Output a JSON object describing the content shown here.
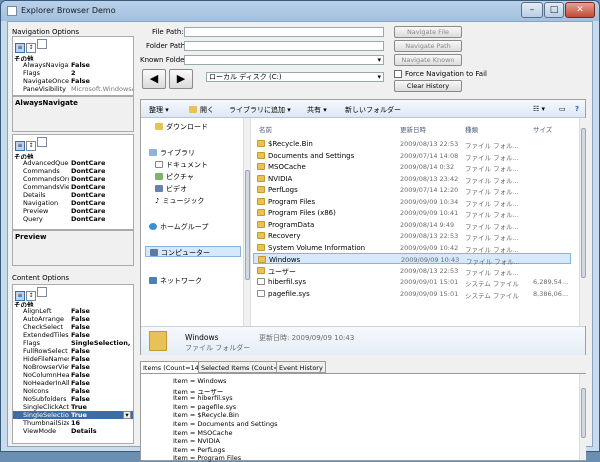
{
  "window": {
    "title": "Explorer Browser Demo",
    "min": "–",
    "max": "□",
    "close": "✕"
  },
  "nav_options": {
    "label": "Navigation Options",
    "category": "その他",
    "rows": [
      {
        "k": "AlwaysNavigate",
        "v": "False"
      },
      {
        "k": "Flags",
        "v": "2"
      },
      {
        "k": "NavigateOnce",
        "v": "False"
      },
      {
        "k": "PaneVisibility",
        "v": "Microsoft.WindowsAP"
      }
    ],
    "description": "AlwaysNavigate"
  },
  "preview_options": {
    "category": "その他",
    "rows": [
      {
        "k": "AdvancedQuery",
        "v": "DontCare"
      },
      {
        "k": "Commands",
        "v": "DontCare"
      },
      {
        "k": "CommandsOrga",
        "v": "DontCare"
      },
      {
        "k": "CommandsView",
        "v": "DontCare"
      },
      {
        "k": "Details",
        "v": "DontCare"
      },
      {
        "k": "Navigation",
        "v": "DontCare"
      },
      {
        "k": "Preview",
        "v": "DontCare"
      },
      {
        "k": "Query",
        "v": "DontCare"
      }
    ],
    "description": "Preview"
  },
  "content_options": {
    "label": "Content Options",
    "category": "その他",
    "rows": [
      {
        "k": "AlignLeft",
        "v": "False"
      },
      {
        "k": "AutoArrange",
        "v": "False"
      },
      {
        "k": "CheckSelect",
        "v": "False"
      },
      {
        "k": "ExtendedTiles",
        "v": "False"
      },
      {
        "k": "Flags",
        "v": "SingleSelection, S"
      },
      {
        "k": "FullRowSelect",
        "v": "False"
      },
      {
        "k": "HideFileNames",
        "v": "False"
      },
      {
        "k": "NoBrowserView",
        "v": "False"
      },
      {
        "k": "NoColumnHead",
        "v": "False"
      },
      {
        "k": "NoHeaderInAllV",
        "v": "False"
      },
      {
        "k": "NoIcons",
        "v": "False"
      },
      {
        "k": "NoSubfolders",
        "v": "False"
      },
      {
        "k": "SingleClickActi",
        "v": "True"
      },
      {
        "k": "SingleSelection",
        "v": "True"
      },
      {
        "k": "ThumbnailSize",
        "v": "16"
      },
      {
        "k": "ViewMode",
        "v": "Details"
      }
    ]
  },
  "top": {
    "file_path_label": "File Path:",
    "folder_path_label": "Folder Path:",
    "known_folder_label": "Known Folder:",
    "file_path": "",
    "folder_path": "",
    "known_folder": "",
    "location": "ローカル ディスク (C:)",
    "back": "◀",
    "forward": "▶",
    "navigate_file": "Navigate File",
    "navigate_path": "Navigate Path",
    "navigate_known": "Navigate Known",
    "force_nav": "Force Navigation to Fail",
    "clear_history": "Clear History"
  },
  "commandbar": {
    "organize": "整理 ▾",
    "open": "開く",
    "add_library": "ライブラリに追加 ▾",
    "share": "共有 ▾",
    "new_folder": "新しいフォルダー"
  },
  "navpane": {
    "downloads": "ダウンロード",
    "libraries": "ライブラリ",
    "documents": "ドキュメント",
    "pictures": "ピクチャ",
    "videos": "ビデオ",
    "music": "ミュージック",
    "homegroup": "ホームグループ",
    "computer": "コンピューター",
    "network": "ネットワーク"
  },
  "files": {
    "headers": {
      "name": "名前",
      "date": "更新日時",
      "type": "種類",
      "size": "サイズ"
    },
    "rows": [
      {
        "n": "$Recycle.Bin",
        "d": "2009/08/13 22:53",
        "t": "ファイル フォル...",
        "s": "",
        "doc": false,
        "sel": false
      },
      {
        "n": "Documents and Settings",
        "d": "2009/07/14 14:08",
        "t": "ファイル フォル...",
        "s": "",
        "doc": false,
        "sel": false
      },
      {
        "n": "MSOCache",
        "d": "2009/08/14 0:32",
        "t": "ファイル フォル...",
        "s": "",
        "doc": false,
        "sel": false
      },
      {
        "n": "NVIDIA",
        "d": "2009/08/13 23:42",
        "t": "ファイル フォル...",
        "s": "",
        "doc": false,
        "sel": false
      },
      {
        "n": "PerfLogs",
        "d": "2009/07/14 12:20",
        "t": "ファイル フォル...",
        "s": "",
        "doc": false,
        "sel": false
      },
      {
        "n": "Program Files",
        "d": "2009/09/09 10:34",
        "t": "ファイル フォル...",
        "s": "",
        "doc": false,
        "sel": false
      },
      {
        "n": "Program Files (x86)",
        "d": "2009/09/09 10:41",
        "t": "ファイル フォル...",
        "s": "",
        "doc": false,
        "sel": false
      },
      {
        "n": "ProgramData",
        "d": "2009/08/14 9:49",
        "t": "ファイル フォル...",
        "s": "",
        "doc": false,
        "sel": false
      },
      {
        "n": "Recovery",
        "d": "2009/08/13 22:53",
        "t": "ファイル フォル...",
        "s": "",
        "doc": false,
        "sel": false
      },
      {
        "n": "System Volume Information",
        "d": "2009/09/09 10:42",
        "t": "ファイル フォル...",
        "s": "",
        "doc": false,
        "sel": false
      },
      {
        "n": "Windows",
        "d": "2009/09/09 10:43",
        "t": "ファイル フォル...",
        "s": "",
        "doc": false,
        "sel": true
      },
      {
        "n": "ユーザー",
        "d": "2009/08/13 22:53",
        "t": "ファイル フォル...",
        "s": "",
        "doc": false,
        "sel": false
      },
      {
        "n": "hiberfil.sys",
        "d": "2009/09/01 15:01",
        "t": "システム ファイル",
        "s": "6,289,54...",
        "doc": true,
        "sel": false
      },
      {
        "n": "pagefile.sys",
        "d": "2009/09/09 15:01",
        "t": "システム ファイル",
        "s": "8,386,06...",
        "doc": true,
        "sel": false
      }
    ]
  },
  "details": {
    "name": "Windows",
    "type": "ファイル フォルダー",
    "modified": "更新日時: 2009/09/09 10:43"
  },
  "tabs": {
    "items": "Items (Count=14)",
    "selected": "Selected Items (Count=1)",
    "events": "Event History"
  },
  "log": [
    "Item = Windows",
    "Item = ユーザー",
    "Item = hiberfil.sys",
    "Item = pagefile.sys",
    "Item = $Recycle.Bin",
    "Item = Documents and Settings",
    "Item = MSOCache",
    "Item = NVIDIA",
    "Item = PerfLogs",
    "Item = Program Files"
  ]
}
